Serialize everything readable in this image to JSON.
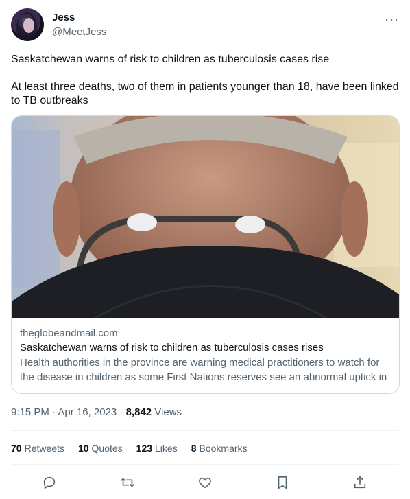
{
  "user": {
    "name": "Jess",
    "handle": "@MeetJess"
  },
  "more_label": "···",
  "tweet": {
    "paragraph1": "Saskatchewan warns of risk to children as tuberculosis cases rise",
    "paragraph2": "At least three deaths, two of them in patients younger than 18, have been linked to TB outbreaks"
  },
  "card": {
    "domain": "theglobeandmail.com",
    "title": "Saskatchewan warns of risk to children as tuberculosis cases rises",
    "description": "Health authorities in the province are warning medical practitioners to watch for the disease in children as some First Nations reserves see an abnormal uptick in ..."
  },
  "meta": {
    "time": "9:15 PM · Apr 16, 2023 · ",
    "views_count": "8,842",
    "views_label": " Views"
  },
  "stats": {
    "retweets_count": "70",
    "retweets_label": "Retweets",
    "quotes_count": "10",
    "quotes_label": "Quotes",
    "likes_count": "123",
    "likes_label": "Likes",
    "bookmarks_count": "8",
    "bookmarks_label": "Bookmarks"
  },
  "icons": [
    "reply-icon",
    "retweet-icon",
    "like-icon",
    "bookmark-icon",
    "share-icon"
  ],
  "colors": {
    "text": "#0f1419",
    "secondary": "#536471",
    "border": "#cfd9de"
  }
}
